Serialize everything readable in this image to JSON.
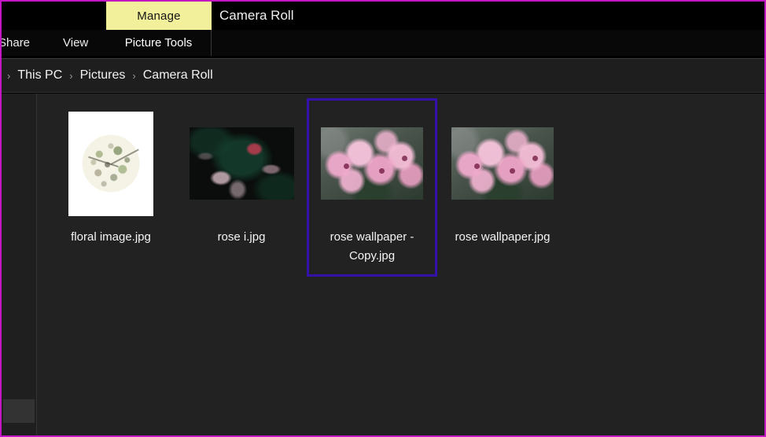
{
  "window": {
    "title": "Camera Roll",
    "active_tab": "Manage",
    "contextual_group": "Picture Tools",
    "accent_highlight": "#f2f09b",
    "frame_color": "#c317c3",
    "selection_border": "#3311aa"
  },
  "ribbon": {
    "tabs": [
      {
        "label": "Manage",
        "active": true
      }
    ],
    "menus": [
      {
        "label": "Share"
      },
      {
        "label": "View"
      }
    ]
  },
  "breadcrumb": {
    "separator": "›",
    "items": [
      {
        "label": "This PC"
      },
      {
        "label": "Pictures"
      },
      {
        "label": "Camera Roll"
      }
    ]
  },
  "files": [
    {
      "name": "floral image.jpg",
      "thumb": "floral-white-botanical",
      "selected": false
    },
    {
      "name": "rose i.jpg",
      "thumb": "dark-rose-bush",
      "selected": false
    },
    {
      "name": "rose wallpaper - Copy.jpg",
      "thumb": "pink-cherry-blossom",
      "selected": true
    },
    {
      "name": "rose wallpaper.jpg",
      "thumb": "pink-cherry-blossom",
      "selected": false
    }
  ]
}
